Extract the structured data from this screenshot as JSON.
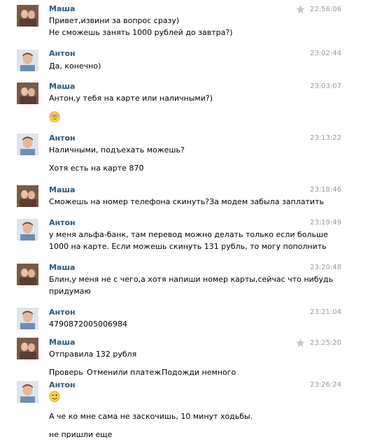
{
  "messages": [
    {
      "author": "Маша",
      "time": "22:56:06",
      "starred": true,
      "lines": [
        "Привет,извини за вопрос сразу)",
        "Не сможешь занять 1000 рублей до завтра?)"
      ]
    },
    {
      "author": "Антон",
      "time": "23:02:44",
      "lines": [
        "Да, конечно)"
      ]
    },
    {
      "author": "Маша",
      "time": "23:03:07",
      "lines": [
        "Антон,у тебя на карте или наличными?)"
      ],
      "emoji": "confused-face"
    },
    {
      "author": "Антон",
      "time": "23:13:22",
      "lines": [
        "Наличными, подъехать можешь?",
        "Хотя есть на карте 870"
      ]
    },
    {
      "author": "Маша",
      "time": "23:18:46",
      "lines": [
        "Сможешь на номер телефона скинуть?За модем забыла заплатить"
      ]
    },
    {
      "author": "Антон",
      "time": "23:19:49",
      "lines": [
        "у меня альфа-банк, там перевод можно делать только если больше",
        "1000 на карте. Если можешь скинуть 131 рубль, то могу пополнить"
      ]
    },
    {
      "author": "Маша",
      "time": "23:20:48",
      "lines": [
        "Блин,у меня не с чего,а хотя напиши номер карты,сейчас что нибудь",
        "придумаю"
      ]
    },
    {
      "author": "Антон",
      "time": "23:21:04",
      "lines": [
        "4790872005006984"
      ]
    },
    {
      "author": "Маша",
      "time": "23:25:20",
      "starred": true,
      "lines": [
        "Отправила 132 рубля"
      ]
    },
    {
      "author": "Антон",
      "time": "23:26:24",
      "emoji": "winking-face",
      "lines": [
        "А че ко мне сама не заскочишь, 10 минут ходьбы.",
        "не пришли еще"
      ]
    }
  ],
  "actions": [
    "Проверь",
    "Отменили платеж",
    "Подожди немного"
  ],
  "colors": {
    "name": "#2b587a",
    "time": "#999999",
    "star": "#c8c8c8"
  }
}
